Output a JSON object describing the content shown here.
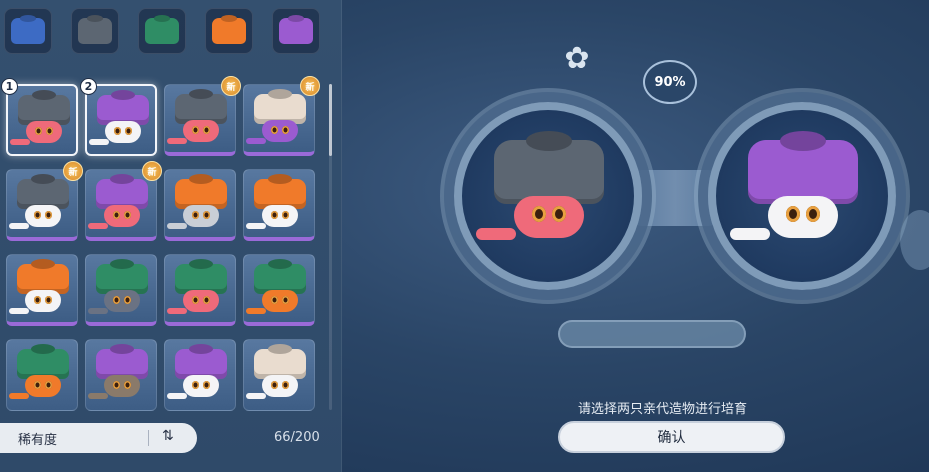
{
  "filters": [
    {
      "color": "#3d6bc4",
      "name": "blue-hat-filter"
    },
    {
      "color": "#5c6672",
      "name": "gray-hat-filter"
    },
    {
      "color": "#2f8d65",
      "name": "green-hat-filter"
    },
    {
      "color": "#f07a2a",
      "name": "orange-hat-filter"
    },
    {
      "color": "#9b5bd0",
      "name": "purple-hat-filter"
    }
  ],
  "cards": [
    {
      "hat": "#5c6672",
      "body": "#ef6a7a",
      "selected": true,
      "num": "1",
      "new": false,
      "purple_border": true
    },
    {
      "hat": "#9b5bd0",
      "body": "#f4f4f6",
      "selected": true,
      "num": "2",
      "new": false,
      "purple_border": true
    },
    {
      "hat": "#5c6672",
      "body": "#ef6a7a",
      "selected": false,
      "num": "",
      "new": true,
      "purple_border": true
    },
    {
      "hat": "#e9dccf",
      "body": "#9b5bd0",
      "selected": false,
      "num": "",
      "new": true,
      "purple_border": true
    },
    {
      "hat": "#5c6672",
      "body": "#f4f4f6",
      "selected": false,
      "num": "",
      "new": true,
      "purple_border": true
    },
    {
      "hat": "#9b5bd0",
      "body": "#ef6a7a",
      "selected": false,
      "num": "",
      "new": true,
      "purple_border": true
    },
    {
      "hat": "#f07a2a",
      "body": "#c9ced6",
      "selected": false,
      "num": "",
      "new": false,
      "purple_border": true
    },
    {
      "hat": "#f07a2a",
      "body": "#f4f4f6",
      "selected": false,
      "num": "",
      "new": false,
      "purple_border": true
    },
    {
      "hat": "#f07a2a",
      "body": "#f4f4f6",
      "selected": false,
      "num": "",
      "new": false,
      "purple_border": true
    },
    {
      "hat": "#2f8d65",
      "body": "#6a7283",
      "selected": false,
      "num": "",
      "new": false,
      "purple_border": true
    },
    {
      "hat": "#2f8d65",
      "body": "#ef6a7a",
      "selected": false,
      "num": "",
      "new": false,
      "purple_border": true
    },
    {
      "hat": "#2f8d65",
      "body": "#f07a2a",
      "selected": false,
      "num": "",
      "new": false,
      "purple_border": true
    },
    {
      "hat": "#2f8d65",
      "body": "#f07a2a",
      "selected": false,
      "num": "",
      "new": false,
      "purple_border": false
    },
    {
      "hat": "#9b5bd0",
      "body": "#8a7a6a",
      "selected": false,
      "num": "",
      "new": false,
      "purple_border": false
    },
    {
      "hat": "#9b5bd0",
      "body": "#f4f4f6",
      "selected": false,
      "num": "",
      "new": false,
      "purple_border": false
    },
    {
      "hat": "#e9dccf",
      "body": "#f4f4f6",
      "selected": false,
      "num": "",
      "new": false,
      "purple_border": false
    }
  ],
  "new_badge_label": "新",
  "sort": {
    "label": "稀有度",
    "icon": "⇅"
  },
  "count": "66/200",
  "breeding": {
    "percent": "90%",
    "parent_left": {
      "hat": "#5c6672",
      "body": "#ef6a7a"
    },
    "parent_right": {
      "hat": "#9b5bd0",
      "body": "#f4f4f6"
    },
    "prompt": "请选择两只亲代造物进行培育",
    "confirm_label": "确认"
  }
}
